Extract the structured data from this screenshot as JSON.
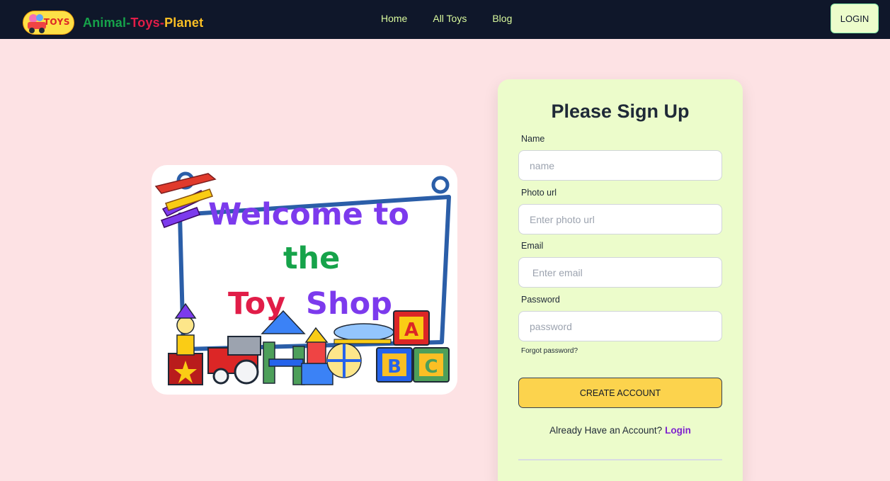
{
  "navbar": {
    "logo_text": "TOYS",
    "brand_part1": "Animal-",
    "brand_part2": "Toys-",
    "brand_part3": "Planet",
    "links": [
      "Home",
      "All Toys",
      "Blog"
    ],
    "login_label": "LOGIN"
  },
  "welcome_image": {
    "line1": "Welcome to",
    "line2": "the",
    "line3_word1": "Toy",
    "line3_word2": "Shop",
    "block_letters": [
      "A",
      "B",
      "C"
    ]
  },
  "signup": {
    "title": "Please Sign Up",
    "fields": [
      {
        "label": "Name",
        "placeholder": "name"
      },
      {
        "label": "Photo url",
        "placeholder": "Enter photo url"
      },
      {
        "label": "Email",
        "placeholder": " Enter email"
      },
      {
        "label": "Password",
        "placeholder": "password"
      }
    ],
    "forgot_label": "Forgot password?",
    "create_label": "CREATE ACCOUNT",
    "already_text": "Already Have an Account?",
    "login_link": "Login"
  },
  "colors": {
    "page_bg": "#fde2e4",
    "navbar_bg": "#0f172a",
    "card_bg": "#ecfccb",
    "button_bg": "#fcd34d",
    "link_purple": "#7e22ce"
  }
}
